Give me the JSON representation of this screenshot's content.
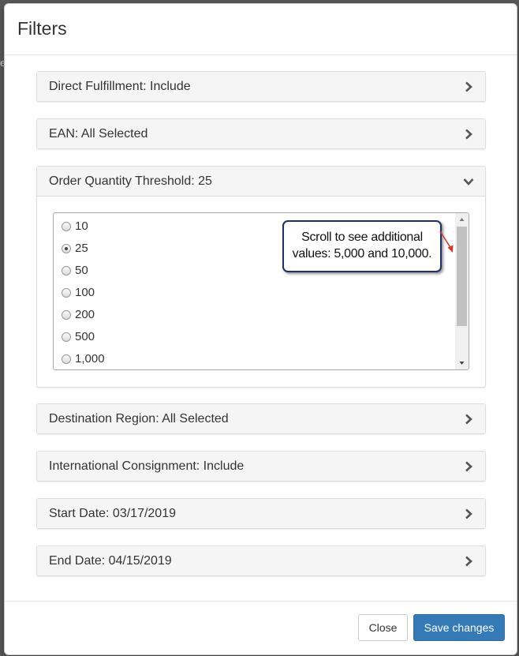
{
  "backdrop": {
    "text": "e"
  },
  "modal": {
    "title": "Filters",
    "panels": [
      {
        "label": "Direct Fulfillment: Include",
        "expanded": false
      },
      {
        "label": "EAN: All Selected",
        "expanded": false
      },
      {
        "label": "Order Quantity Threshold: 25",
        "expanded": true
      },
      {
        "label": "Destination Region: All Selected",
        "expanded": false
      },
      {
        "label": "International Consignment: Include",
        "expanded": false
      },
      {
        "label": "Start Date: 03/17/2019",
        "expanded": false
      },
      {
        "label": "End Date: 04/15/2019",
        "expanded": false
      }
    ],
    "threshold_options": [
      {
        "label": "10",
        "selected": false
      },
      {
        "label": "25",
        "selected": true
      },
      {
        "label": "50",
        "selected": false
      },
      {
        "label": "100",
        "selected": false
      },
      {
        "label": "200",
        "selected": false
      },
      {
        "label": "500",
        "selected": false
      },
      {
        "label": "1,000",
        "selected": false
      }
    ],
    "callout": {
      "line1": "Scroll to see additional",
      "line2": "values: 5,000 and 10,000."
    },
    "footer": {
      "close_label": "Close",
      "save_label": "Save changes"
    }
  },
  "colors": {
    "primary": "#337ab7",
    "callout_border": "#1f2f6b",
    "callout_arrow": "#d9362b"
  }
}
